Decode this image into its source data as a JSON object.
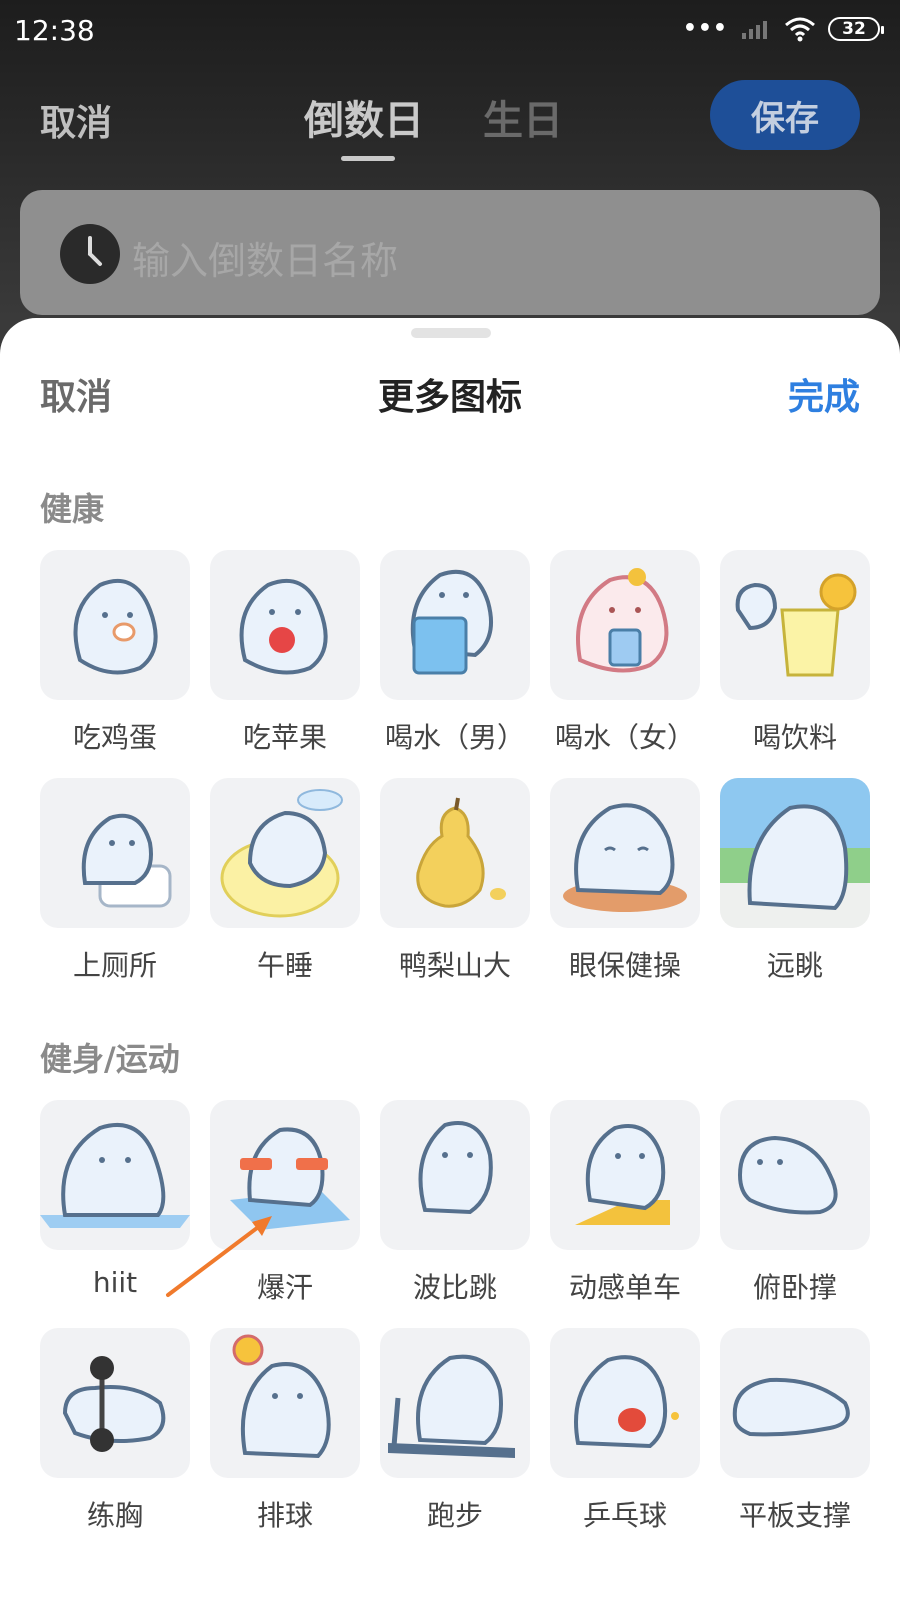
{
  "status": {
    "time": "12:38",
    "dots": "•••",
    "battery": "32"
  },
  "top_bar": {
    "cancel": "取消",
    "tabs": [
      "倒数日",
      "生日"
    ],
    "save": "保存"
  },
  "name_input": {
    "placeholder": "输入倒数日名称"
  },
  "sheet": {
    "cancel": "取消",
    "title": "更多图标",
    "done": "完成",
    "sections": [
      {
        "title": "健康",
        "rows": [
          [
            "吃鸡蛋",
            "吃苹果",
            "喝水（男）",
            "喝水（女）",
            "喝饮料"
          ],
          [
            "上厕所",
            "午睡",
            "鸭梨山大",
            "眼保健操",
            "远眺"
          ]
        ]
      },
      {
        "title": "健身/运动",
        "rows": [
          [
            "hiit",
            "爆汗",
            "波比跳",
            "动感单车",
            "俯卧撑"
          ],
          [
            "练胸",
            "排球",
            "跑步",
            "乒乓球",
            "平板支撑"
          ]
        ]
      }
    ]
  },
  "colors": {
    "accent": "#2e7fe0",
    "save_bg": "#1e4f98",
    "arrow": "#f07a2c"
  }
}
